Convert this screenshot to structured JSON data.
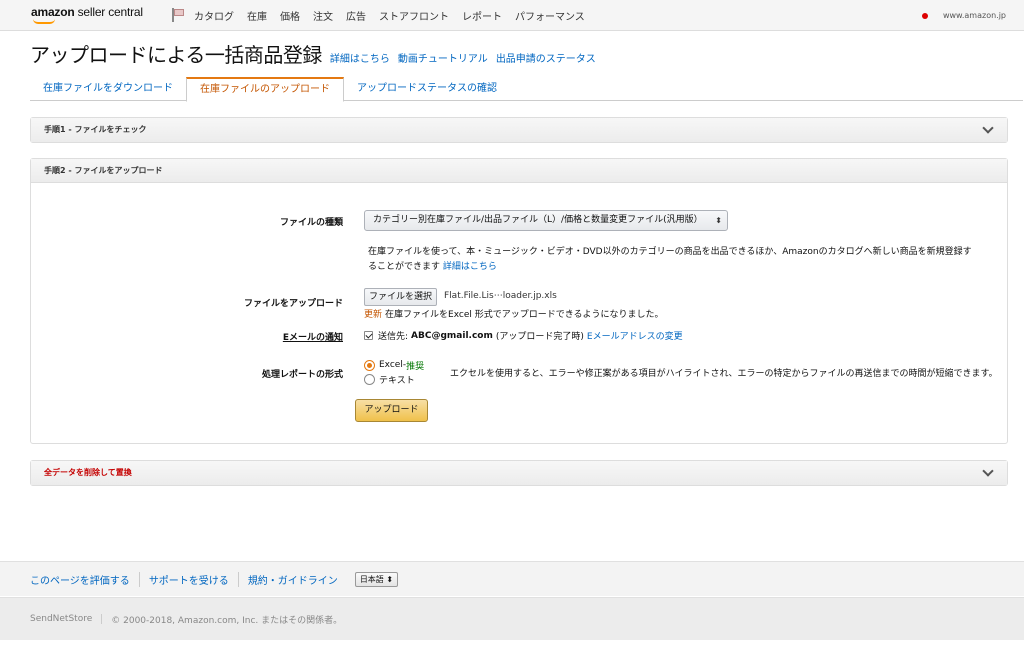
{
  "topnav": {
    "logo_bold": "amazon",
    "logo_light": "seller central",
    "menu": [
      "カタログ",
      "在庫",
      "価格",
      "注文",
      "広告",
      "ストアフロント",
      "レポート",
      "パフォーマンス"
    ],
    "site": "www.amazon.jp"
  },
  "header": {
    "title": "アップロードによる一括商品登録",
    "links": [
      "詳細はこちら",
      "動画チュートリアル",
      "出品申請のステータス"
    ]
  },
  "tabs": [
    {
      "label": "在庫ファイルをダウンロード",
      "active": false
    },
    {
      "label": "在庫ファイルのアップロード",
      "active": true
    },
    {
      "label": "アップロードステータスの確認",
      "active": false
    }
  ],
  "step1": {
    "title": "手順1 - ファイルをチェック"
  },
  "step2": {
    "title": "手順2 - ファイルをアップロード",
    "file_type_label": "ファイルの種類",
    "file_type_value": "カテゴリー別在庫ファイル/出品ファイル（L）/価格と数量変更ファイル(汎用版）",
    "description": "在庫ファイルを使って、本・ミュージック・ビデオ・DVD以外のカテゴリーの商品を出品できるほか、Amazonのカタログへ新しい商品を新規登録することができます",
    "description_link": "詳細はこちら",
    "upload_label": "ファイルをアップロード",
    "choose_file": "ファイルを選択",
    "file_name": "Flat.File.Lis⋯loader.jp.xls",
    "update_tag": "更新",
    "update_text": "在庫ファイルをExcel 形式でアップロードできるようになりました。",
    "email_label": "Eメールの通知",
    "email_prefix": "送信先:",
    "email_address": "ABC@gmail.com",
    "email_suffix": "(アップロード完了時)",
    "email_change": "Eメールアドレスの変更",
    "report_label": "処理レポートの形式",
    "option_excel": "Excel",
    "option_excel_sep": " - ",
    "option_excel_recommend": "推奨",
    "option_text": "テキスト",
    "selected_format": "Excel",
    "format_desc": "エクセルを使用すると、エラーや修正案がある項目がハイライトされ、エラーの特定からファイルの再送信までの時間が短縮できます。",
    "upload_button": "アップロード"
  },
  "step3": {
    "title": "全データを削除して置換"
  },
  "footer": {
    "links": [
      "このページを評価する",
      "サポートを受ける",
      "規約・ガイドライン"
    ],
    "language": "日本語 ⬍",
    "store": "SendNetStore",
    "copyright": "© 2000-2018, Amazon.com, Inc. またはその関係者。"
  },
  "colors": {
    "link": "#0066c0",
    "accent": "#e47911",
    "danger": "#c40000",
    "button": "#f0c14b"
  }
}
